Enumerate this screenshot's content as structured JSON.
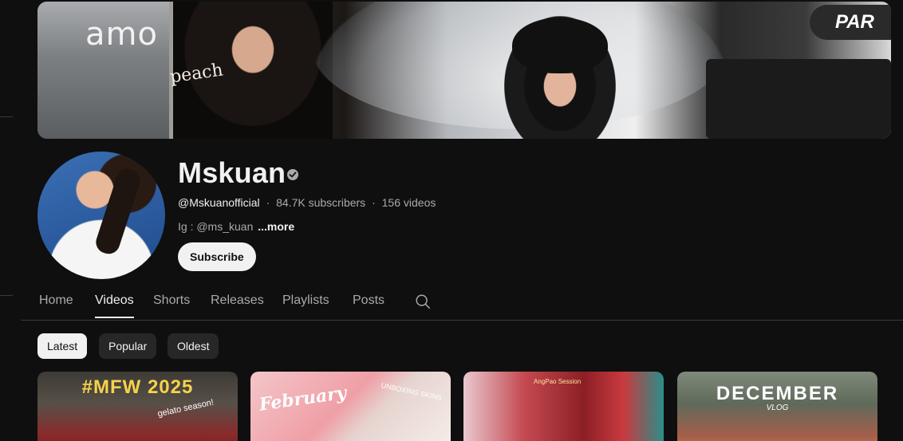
{
  "banner": {
    "store_sign": "amo",
    "wall_text": "peach",
    "corner_sign": "PAR"
  },
  "channel": {
    "name": "Mskuan",
    "handle": "@Mskuanofficial",
    "subscribers": "84.7K subscribers",
    "videos": "156 videos",
    "separator": "·",
    "description": "Ig : @ms_kuan",
    "more_label": "...more",
    "subscribe_label": "Subscribe"
  },
  "tabs": [
    {
      "label": "Home",
      "active": false
    },
    {
      "label": "Videos",
      "active": true
    },
    {
      "label": "Shorts",
      "active": false
    },
    {
      "label": "Releases",
      "active": false
    },
    {
      "label": "Playlists",
      "active": false
    },
    {
      "label": "Posts",
      "active": false
    }
  ],
  "chips": [
    {
      "label": "Latest",
      "selected": true
    },
    {
      "label": "Popular",
      "selected": false
    },
    {
      "label": "Oldest",
      "selected": false
    }
  ],
  "thumbnails": [
    {
      "title": "#MFW 2025",
      "subtitle": "gelato season!"
    },
    {
      "title": "February",
      "subtitle": "UNBOXING SKINS"
    },
    {
      "title": "",
      "subtitle": "AngPao Session"
    },
    {
      "title": "DECEMBER",
      "subtitle": "VLOG"
    }
  ],
  "icons": {
    "verified": "verified-icon",
    "search": "search-icon"
  },
  "colors": {
    "background": "#0f0f0f",
    "text_primary": "#f1f1f1",
    "text_secondary": "#aaaaaa",
    "chip_bg": "#272727"
  }
}
